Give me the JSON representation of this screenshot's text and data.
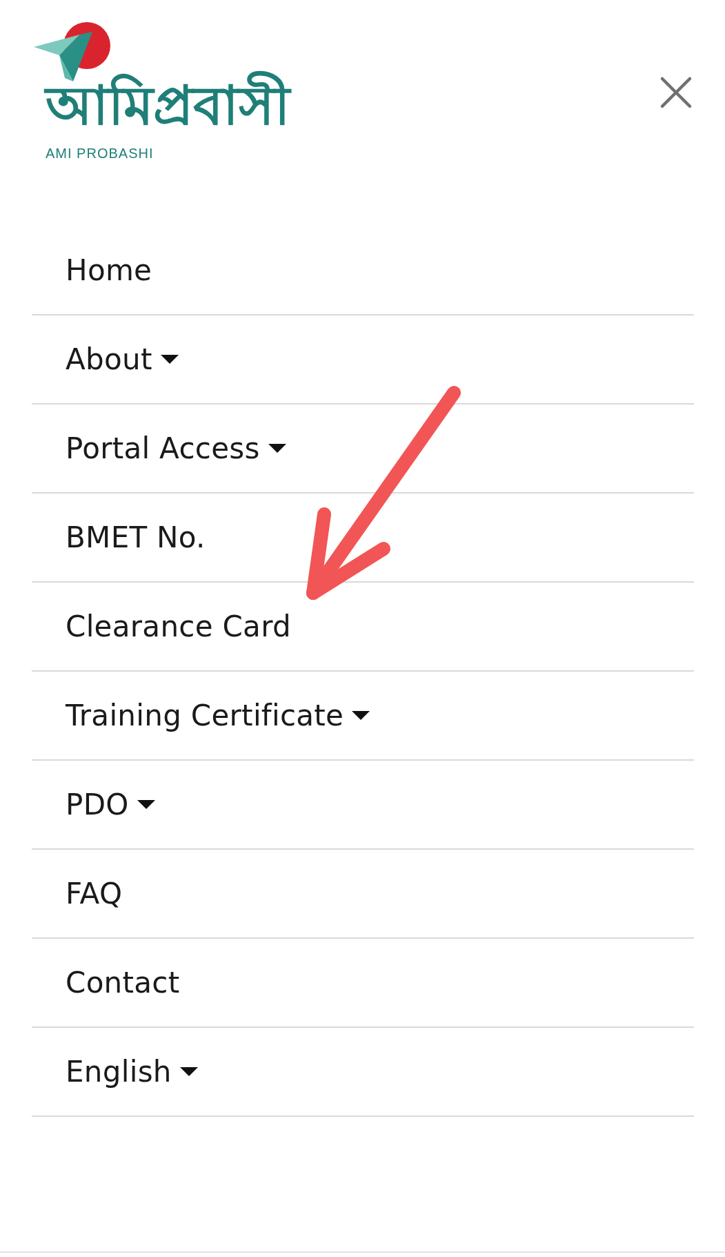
{
  "logo": {
    "wordmark": "আমিপ্রবাসী",
    "caption": "AMI PROBASHI"
  },
  "menu": [
    {
      "label": "Home",
      "dropdown": false
    },
    {
      "label": "About",
      "dropdown": true
    },
    {
      "label": "Portal Access",
      "dropdown": true
    },
    {
      "label": "BMET No.",
      "dropdown": false
    },
    {
      "label": "Clearance Card",
      "dropdown": false
    },
    {
      "label": "Training Certificate",
      "dropdown": true
    },
    {
      "label": "PDO",
      "dropdown": true
    },
    {
      "label": "FAQ",
      "dropdown": false
    },
    {
      "label": "Contact",
      "dropdown": false
    },
    {
      "label": "English",
      "dropdown": true
    }
  ]
}
